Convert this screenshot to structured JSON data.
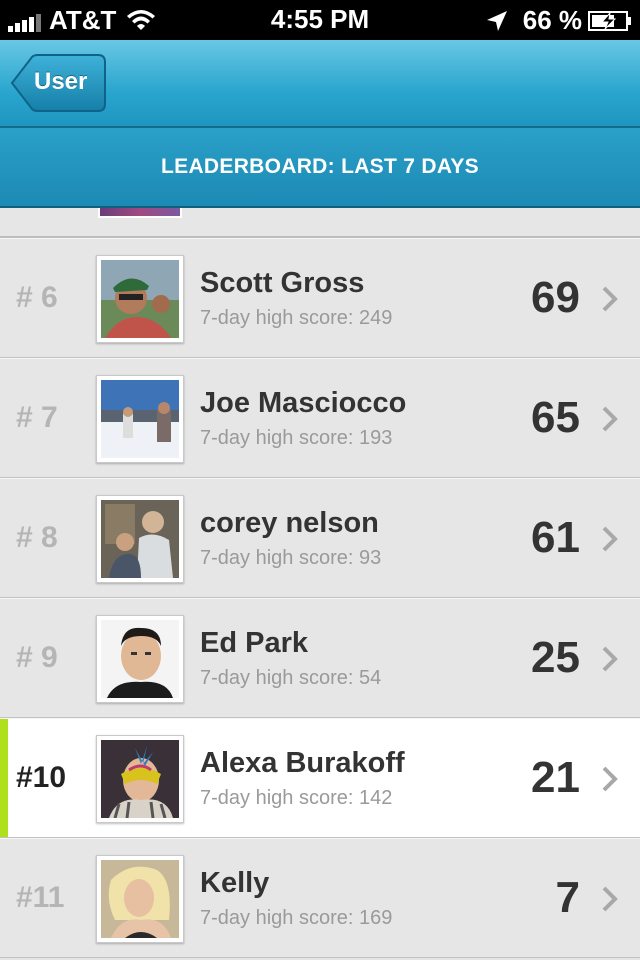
{
  "status": {
    "carrier": "AT&T",
    "time": "4:55 PM",
    "battery": "66 %"
  },
  "nav": {
    "back_label": "User"
  },
  "header": {
    "title": "LEADERBOARD: LAST 7 DAYS"
  },
  "colors": {
    "nav_blue": "#2aa6ce",
    "current_accent": "#aee01b"
  },
  "rows": [
    {
      "rank": "# 6",
      "name": "Scott Gross",
      "sub": "7-day high score: 249",
      "score": "69",
      "current": false
    },
    {
      "rank": "# 7",
      "name": "Joe Masciocco",
      "sub": "7-day high score: 193",
      "score": "65",
      "current": false
    },
    {
      "rank": "# 8",
      "name": "corey nelson",
      "sub": "7-day high score: 93",
      "score": "61",
      "current": false
    },
    {
      "rank": "# 9",
      "name": "Ed Park",
      "sub": "7-day high score: 54",
      "score": "25",
      "current": false
    },
    {
      "rank": "#10",
      "name": "Alexa Burakoff",
      "sub": "7-day high score: 142",
      "score": "21",
      "current": true
    },
    {
      "rank": "#11",
      "name": "Kelly",
      "sub": "7-day high score: 169",
      "score": "7",
      "current": false
    }
  ]
}
